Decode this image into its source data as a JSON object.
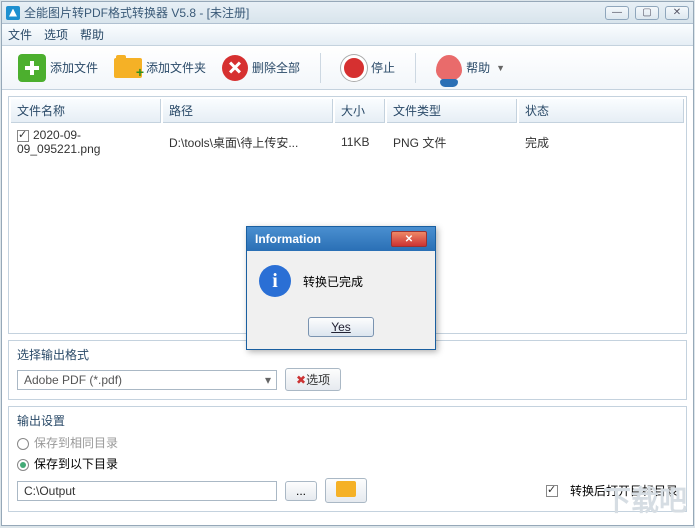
{
  "window": {
    "title": "全能图片转PDF格式转换器 V5.8 - [未注册]"
  },
  "menu": {
    "file": "文件",
    "options": "选项",
    "help": "帮助"
  },
  "toolbar": {
    "add_file": "添加文件",
    "add_folder": "添加文件夹",
    "delete_all": "删除全部",
    "stop": "停止",
    "help": "帮助"
  },
  "table": {
    "headers": {
      "name": "文件名称",
      "path": "路径",
      "size": "大小",
      "type": "文件类型",
      "status": "状态"
    },
    "rows": [
      {
        "checked": true,
        "name": "2020-09-09_095221.png",
        "path": "D:\\tools\\桌面\\待上传安...",
        "size": "11KB",
        "type": "PNG 文件",
        "status": "完成"
      }
    ]
  },
  "format": {
    "section_title": "选择输出格式",
    "selected": "Adobe PDF (*.pdf)",
    "options_btn": "选项"
  },
  "output": {
    "section_title": "输出设置",
    "same_dir": "保存到相同目录",
    "below_dir": "保存到以下目录",
    "path": "C:\\Output",
    "open_after": "转换后打开目标目录",
    "open_after_checked": true,
    "selected_radio": "below"
  },
  "dialog": {
    "title": "Information",
    "message": "转换已完成",
    "yes": "Yes"
  },
  "watermark": "下载吧"
}
